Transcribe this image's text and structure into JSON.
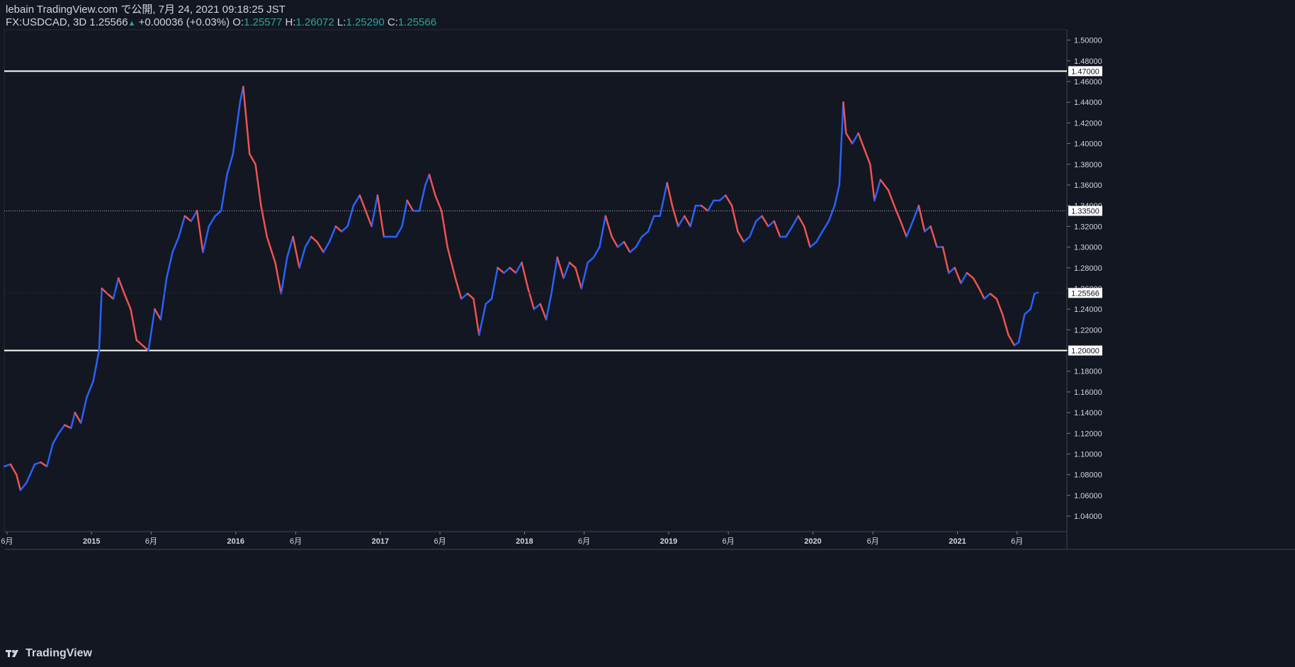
{
  "header": {
    "published": "lebain TradingView.com で公開, 7月 24, 2021 09:18:25 JST",
    "symbol": "FX:USDCAD, 3D",
    "last": "1.25566",
    "change": "+0.00036 (+0.03%)",
    "o_label": "O:",
    "o_value": "1.25577",
    "h_label": "H:",
    "h_value": "1.26072",
    "l_label": "L:",
    "l_value": "1.25290",
    "c_label": "C:",
    "c_value": "1.25566"
  },
  "footer": {
    "brand": "TradingView"
  },
  "colors": {
    "background": "#131722",
    "up": "#2962ff",
    "down": "#ef5350",
    "wick": "#787b86",
    "grid": "#2a2e39",
    "text": "#d1d4dc",
    "accent": "#26a69a"
  },
  "chart_data": {
    "type": "line",
    "title": "",
    "ylim": [
      1.025,
      1.51
    ],
    "y_ticks": [
      "1.50000",
      "1.48000",
      "1.46000",
      "1.44000",
      "1.42000",
      "1.40000",
      "1.38000",
      "1.36000",
      "1.34000",
      "1.32000",
      "1.30000",
      "1.28000",
      "1.26000",
      "1.24000",
      "1.22000",
      "1.20000",
      "1.18000",
      "1.16000",
      "1.14000",
      "1.12000",
      "1.10000",
      "1.08000",
      "1.06000",
      "1.04000"
    ],
    "x_ticks": [
      {
        "label": "6月",
        "date": "2014-06-01"
      },
      {
        "label": "2015",
        "date": "2015-01-01"
      },
      {
        "label": "6月",
        "date": "2015-06-01"
      },
      {
        "label": "2016",
        "date": "2016-01-01"
      },
      {
        "label": "6月",
        "date": "2016-06-01"
      },
      {
        "label": "2017",
        "date": "2017-01-01"
      },
      {
        "label": "6月",
        "date": "2017-06-01"
      },
      {
        "label": "2018",
        "date": "2018-01-01"
      },
      {
        "label": "6月",
        "date": "2018-06-01"
      },
      {
        "label": "2019",
        "date": "2019-01-01"
      },
      {
        "label": "6月",
        "date": "2019-06-01"
      },
      {
        "label": "2020",
        "date": "2020-01-01"
      },
      {
        "label": "6月",
        "date": "2020-06-01"
      },
      {
        "label": "2021",
        "date": "2021-01-01"
      },
      {
        "label": "6月",
        "date": "2021-06-01"
      }
    ],
    "x_range": [
      "2014-05-25",
      "2021-10-05"
    ],
    "series": [
      {
        "price_path": [
          [
            "2014-05-25",
            1.088
          ],
          [
            "2014-06-10",
            1.09
          ],
          [
            "2014-06-25",
            1.08
          ],
          [
            "2014-07-05",
            1.065
          ],
          [
            "2014-07-20",
            1.072
          ],
          [
            "2014-08-10",
            1.09
          ],
          [
            "2014-08-25",
            1.092
          ],
          [
            "2014-09-10",
            1.088
          ],
          [
            "2014-09-25",
            1.11
          ],
          [
            "2014-10-10",
            1.12
          ],
          [
            "2014-10-25",
            1.128
          ],
          [
            "2014-11-10",
            1.125
          ],
          [
            "2014-11-20",
            1.14
          ],
          [
            "2014-12-05",
            1.13
          ],
          [
            "2014-12-20",
            1.155
          ],
          [
            "2015-01-05",
            1.17
          ],
          [
            "2015-01-20",
            1.2
          ],
          [
            "2015-01-27",
            1.26
          ],
          [
            "2015-02-10",
            1.255
          ],
          [
            "2015-02-25",
            1.25
          ],
          [
            "2015-03-10",
            1.27
          ],
          [
            "2015-03-25",
            1.255
          ],
          [
            "2015-04-10",
            1.24
          ],
          [
            "2015-04-25",
            1.21
          ],
          [
            "2015-05-10",
            1.205
          ],
          [
            "2015-05-25",
            1.2
          ],
          [
            "2015-06-10",
            1.24
          ],
          [
            "2015-06-25",
            1.23
          ],
          [
            "2015-07-10",
            1.27
          ],
          [
            "2015-07-25",
            1.295
          ],
          [
            "2015-08-10",
            1.31
          ],
          [
            "2015-08-25",
            1.33
          ],
          [
            "2015-09-10",
            1.325
          ],
          [
            "2015-09-25",
            1.335
          ],
          [
            "2015-10-10",
            1.295
          ],
          [
            "2015-10-25",
            1.32
          ],
          [
            "2015-11-10",
            1.33
          ],
          [
            "2015-11-25",
            1.335
          ],
          [
            "2015-12-10",
            1.37
          ],
          [
            "2015-12-25",
            1.39
          ],
          [
            "2016-01-12",
            1.44
          ],
          [
            "2016-01-20",
            1.455
          ],
          [
            "2016-02-05",
            1.39
          ],
          [
            "2016-02-20",
            1.38
          ],
          [
            "2016-03-05",
            1.34
          ],
          [
            "2016-03-20",
            1.31
          ],
          [
            "2016-04-10",
            1.285
          ],
          [
            "2016-04-25",
            1.255
          ],
          [
            "2016-05-10",
            1.29
          ],
          [
            "2016-05-25",
            1.31
          ],
          [
            "2016-06-10",
            1.28
          ],
          [
            "2016-06-25",
            1.3
          ],
          [
            "2016-07-10",
            1.31
          ],
          [
            "2016-07-25",
            1.305
          ],
          [
            "2016-08-10",
            1.295
          ],
          [
            "2016-08-25",
            1.305
          ],
          [
            "2016-09-10",
            1.32
          ],
          [
            "2016-09-25",
            1.315
          ],
          [
            "2016-10-10",
            1.32
          ],
          [
            "2016-10-25",
            1.34
          ],
          [
            "2016-11-10",
            1.35
          ],
          [
            "2016-11-25",
            1.335
          ],
          [
            "2016-12-10",
            1.32
          ],
          [
            "2016-12-25",
            1.35
          ],
          [
            "2017-01-10",
            1.31
          ],
          [
            "2017-01-25",
            1.31
          ],
          [
            "2017-02-10",
            1.31
          ],
          [
            "2017-02-25",
            1.32
          ],
          [
            "2017-03-10",
            1.345
          ],
          [
            "2017-03-25",
            1.335
          ],
          [
            "2017-04-10",
            1.335
          ],
          [
            "2017-04-25",
            1.36
          ],
          [
            "2017-05-05",
            1.37
          ],
          [
            "2017-05-20",
            1.35
          ],
          [
            "2017-06-05",
            1.335
          ],
          [
            "2017-06-20",
            1.3
          ],
          [
            "2017-07-10",
            1.27
          ],
          [
            "2017-07-25",
            1.25
          ],
          [
            "2017-08-10",
            1.255
          ],
          [
            "2017-08-25",
            1.25
          ],
          [
            "2017-09-08",
            1.215
          ],
          [
            "2017-09-25",
            1.245
          ],
          [
            "2017-10-10",
            1.25
          ],
          [
            "2017-10-25",
            1.28
          ],
          [
            "2017-11-10",
            1.275
          ],
          [
            "2017-11-25",
            1.28
          ],
          [
            "2017-12-10",
            1.275
          ],
          [
            "2017-12-25",
            1.285
          ],
          [
            "2018-01-10",
            1.26
          ],
          [
            "2018-01-25",
            1.24
          ],
          [
            "2018-02-10",
            1.245
          ],
          [
            "2018-02-25",
            1.23
          ],
          [
            "2018-03-10",
            1.255
          ],
          [
            "2018-03-25",
            1.29
          ],
          [
            "2018-04-10",
            1.27
          ],
          [
            "2018-04-25",
            1.285
          ],
          [
            "2018-05-10",
            1.28
          ],
          [
            "2018-05-25",
            1.26
          ],
          [
            "2018-06-10",
            1.285
          ],
          [
            "2018-06-25",
            1.29
          ],
          [
            "2018-07-10",
            1.3
          ],
          [
            "2018-07-25",
            1.33
          ],
          [
            "2018-08-10",
            1.31
          ],
          [
            "2018-08-25",
            1.3
          ],
          [
            "2018-09-10",
            1.305
          ],
          [
            "2018-09-25",
            1.295
          ],
          [
            "2018-10-10",
            1.3
          ],
          [
            "2018-10-25",
            1.31
          ],
          [
            "2018-11-10",
            1.315
          ],
          [
            "2018-11-25",
            1.33
          ],
          [
            "2018-12-10",
            1.33
          ],
          [
            "2018-12-28",
            1.362
          ],
          [
            "2019-01-10",
            1.34
          ],
          [
            "2019-01-25",
            1.32
          ],
          [
            "2019-02-10",
            1.33
          ],
          [
            "2019-02-25",
            1.32
          ],
          [
            "2019-03-10",
            1.34
          ],
          [
            "2019-03-25",
            1.34
          ],
          [
            "2019-04-10",
            1.335
          ],
          [
            "2019-04-25",
            1.345
          ],
          [
            "2019-05-10",
            1.345
          ],
          [
            "2019-05-25",
            1.35
          ],
          [
            "2019-06-10",
            1.34
          ],
          [
            "2019-06-25",
            1.315
          ],
          [
            "2019-07-10",
            1.305
          ],
          [
            "2019-07-25",
            1.31
          ],
          [
            "2019-08-10",
            1.325
          ],
          [
            "2019-08-25",
            1.33
          ],
          [
            "2019-09-10",
            1.32
          ],
          [
            "2019-09-25",
            1.325
          ],
          [
            "2019-10-10",
            1.31
          ],
          [
            "2019-10-25",
            1.31
          ],
          [
            "2019-11-10",
            1.32
          ],
          [
            "2019-11-25",
            1.33
          ],
          [
            "2019-12-10",
            1.32
          ],
          [
            "2019-12-25",
            1.3
          ],
          [
            "2020-01-10",
            1.305
          ],
          [
            "2020-01-25",
            1.315
          ],
          [
            "2020-02-10",
            1.325
          ],
          [
            "2020-02-25",
            1.34
          ],
          [
            "2020-03-08",
            1.36
          ],
          [
            "2020-03-18",
            1.44
          ],
          [
            "2020-03-25",
            1.41
          ],
          [
            "2020-04-10",
            1.4
          ],
          [
            "2020-04-25",
            1.41
          ],
          [
            "2020-05-10",
            1.395
          ],
          [
            "2020-05-25",
            1.38
          ],
          [
            "2020-06-05",
            1.345
          ],
          [
            "2020-06-20",
            1.365
          ],
          [
            "2020-07-10",
            1.355
          ],
          [
            "2020-07-25",
            1.34
          ],
          [
            "2020-08-10",
            1.325
          ],
          [
            "2020-08-25",
            1.31
          ],
          [
            "2020-09-10",
            1.325
          ],
          [
            "2020-09-25",
            1.34
          ],
          [
            "2020-10-10",
            1.315
          ],
          [
            "2020-10-25",
            1.32
          ],
          [
            "2020-11-10",
            1.3
          ],
          [
            "2020-11-25",
            1.3
          ],
          [
            "2020-12-10",
            1.275
          ],
          [
            "2020-12-25",
            1.28
          ],
          [
            "2021-01-10",
            1.265
          ],
          [
            "2021-01-25",
            1.275
          ],
          [
            "2021-02-10",
            1.27
          ],
          [
            "2021-02-25",
            1.26
          ],
          [
            "2021-03-10",
            1.25
          ],
          [
            "2021-03-25",
            1.255
          ],
          [
            "2021-04-10",
            1.25
          ],
          [
            "2021-04-25",
            1.235
          ],
          [
            "2021-05-10",
            1.215
          ],
          [
            "2021-05-25",
            1.205
          ],
          [
            "2021-06-05",
            1.208
          ],
          [
            "2021-06-20",
            1.235
          ],
          [
            "2021-07-05",
            1.24
          ],
          [
            "2021-07-15",
            1.255
          ],
          [
            "2021-07-23",
            1.256
          ]
        ]
      }
    ],
    "horizontal_lines": [
      {
        "value": 1.47,
        "label": "1.47000",
        "style": "solid"
      },
      {
        "value": 1.335,
        "label": "1.33500",
        "style": "dotted"
      },
      {
        "value": 1.2,
        "label": "1.20000",
        "style": "solid"
      }
    ],
    "last_price": {
      "value": 1.25566,
      "label": "1.25566"
    }
  }
}
